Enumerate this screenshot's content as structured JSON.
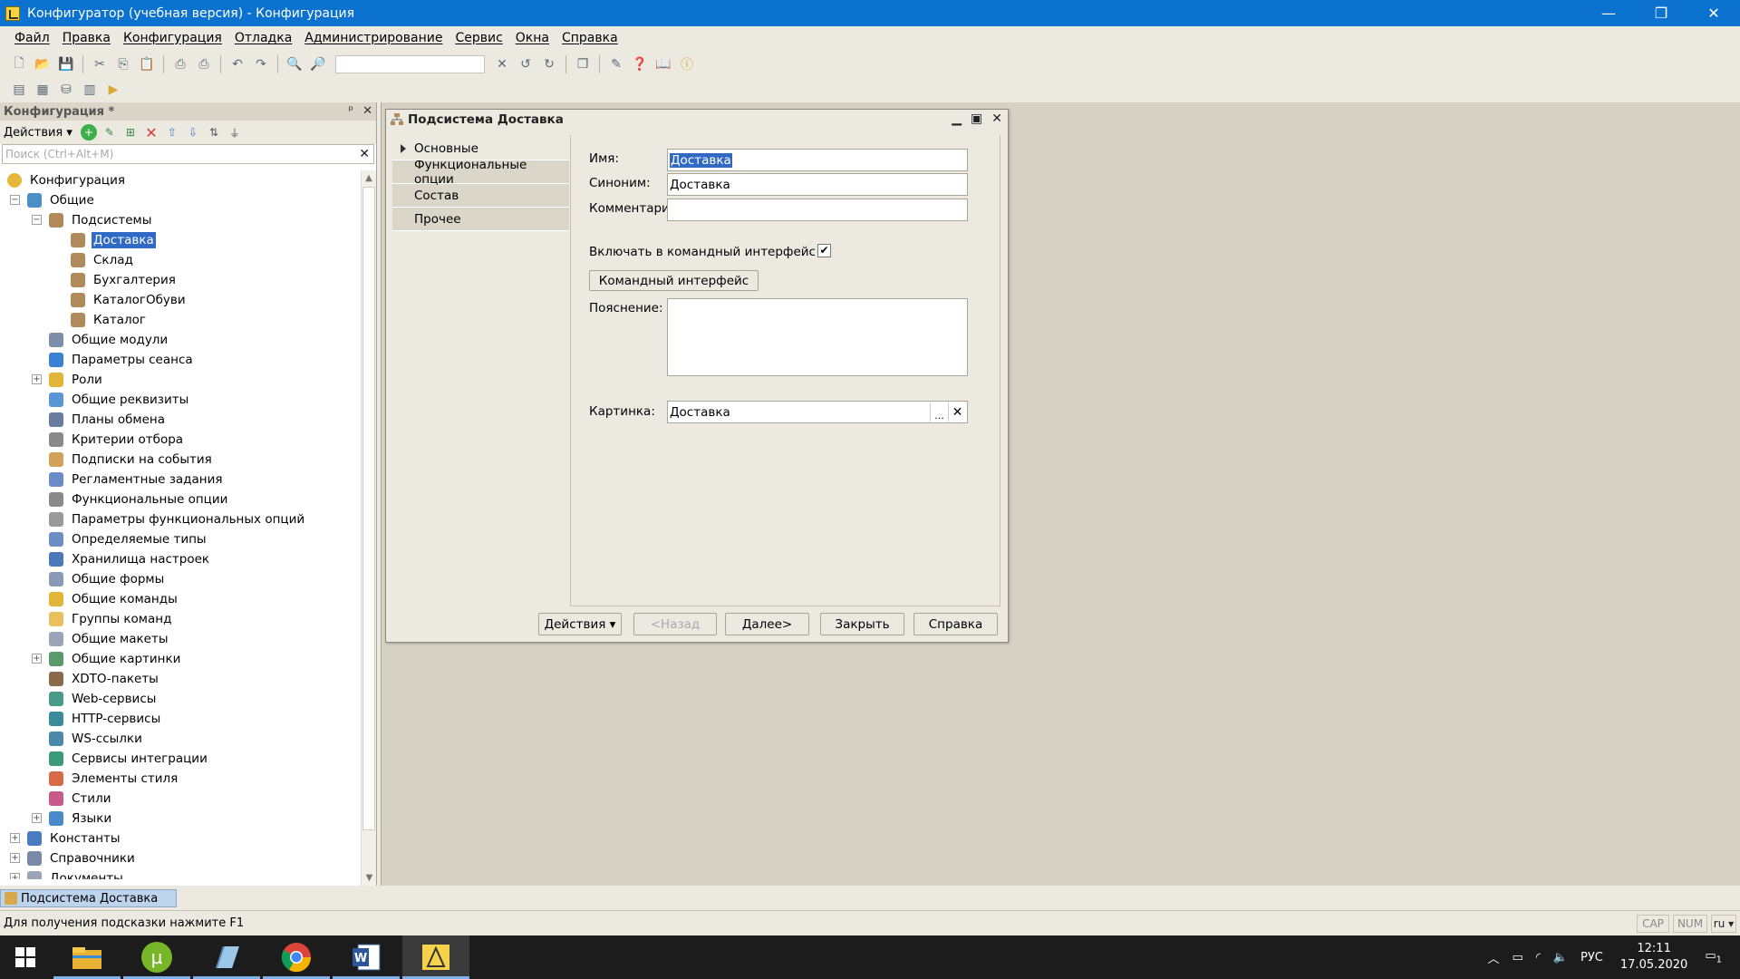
{
  "window": {
    "title": "Конфигуратор (учебная версия) - Конфигурация",
    "minimize": "—",
    "restore": "❐",
    "close": "✕"
  },
  "menu": [
    "Файл",
    "Правка",
    "Конфигурация",
    "Отладка",
    "Администрирование",
    "Сервис",
    "Окна",
    "Справка"
  ],
  "panel": {
    "title": "Конфигурация *",
    "pin": "ᵖ",
    "close": "✕",
    "actions_label": "Действия ▾",
    "search_placeholder": "Поиск (Ctrl+Alt+M)",
    "tree": [
      {
        "label": "Конфигурация",
        "level": 0,
        "exp": "",
        "color": "#e6b73a"
      },
      {
        "label": "Общие",
        "level": 1,
        "exp": "⊖",
        "color": "#4a90c8"
      },
      {
        "label": "Подсистемы",
        "level": 2,
        "exp": "⊖",
        "color": "#b08a5a"
      },
      {
        "label": "Доставка",
        "level": 3,
        "exp": "",
        "color": "#b08a5a",
        "selected": true
      },
      {
        "label": "Склад",
        "level": 3,
        "exp": "",
        "color": "#b08a5a"
      },
      {
        "label": "Бухгалтерия",
        "level": 3,
        "exp": "",
        "color": "#b08a5a"
      },
      {
        "label": "КаталогОбуви",
        "level": 3,
        "exp": "",
        "color": "#b08a5a"
      },
      {
        "label": "Каталог",
        "level": 3,
        "exp": "",
        "color": "#b08a5a"
      },
      {
        "label": "Общие модули",
        "level": 2,
        "exp": "",
        "color": "#7d8fa8"
      },
      {
        "label": "Параметры сеанса",
        "level": 2,
        "exp": "",
        "color": "#3d7fd1"
      },
      {
        "label": "Роли",
        "level": 2,
        "exp": "⊕",
        "color": "#e2b43a"
      },
      {
        "label": "Общие реквизиты",
        "level": 2,
        "exp": "",
        "color": "#5a95d6"
      },
      {
        "label": "Планы обмена",
        "level": 2,
        "exp": "",
        "color": "#6a7ca0"
      },
      {
        "label": "Критерии отбора",
        "level": 2,
        "exp": "",
        "color": "#8a8a8a"
      },
      {
        "label": "Подписки на события",
        "level": 2,
        "exp": "",
        "color": "#d2a25a"
      },
      {
        "label": "Регламентные задания",
        "level": 2,
        "exp": "",
        "color": "#6c8cc8"
      },
      {
        "label": "Функциональные опции",
        "level": 2,
        "exp": "",
        "color": "#8a8a8a"
      },
      {
        "label": "Параметры функциональных опций",
        "level": 2,
        "exp": "",
        "color": "#9a9a9a"
      },
      {
        "label": "Определяемые типы",
        "level": 2,
        "exp": "",
        "color": "#6b8fc4"
      },
      {
        "label": "Хранилища настроек",
        "level": 2,
        "exp": "",
        "color": "#4a78b8"
      },
      {
        "label": "Общие формы",
        "level": 2,
        "exp": "",
        "color": "#8a9ab4"
      },
      {
        "label": "Общие команды",
        "level": 2,
        "exp": "",
        "color": "#e2b43a"
      },
      {
        "label": "Группы команд",
        "level": 2,
        "exp": "",
        "color": "#e8c060"
      },
      {
        "label": "Общие макеты",
        "level": 2,
        "exp": "",
        "color": "#9aa6b8"
      },
      {
        "label": "Общие картинки",
        "level": 2,
        "exp": "⊕",
        "color": "#5a9a6a"
      },
      {
        "label": "XDTO-пакеты",
        "level": 2,
        "exp": "",
        "color": "#8a6a4a"
      },
      {
        "label": "Web-сервисы",
        "level": 2,
        "exp": "",
        "color": "#4a9a8a"
      },
      {
        "label": "HTTP-сервисы",
        "level": 2,
        "exp": "",
        "color": "#3a8a9a"
      },
      {
        "label": "WS-ссылки",
        "level": 2,
        "exp": "",
        "color": "#4a8aa8"
      },
      {
        "label": "Сервисы интеграции",
        "level": 2,
        "exp": "",
        "color": "#3a9a7a"
      },
      {
        "label": "Элементы стиля",
        "level": 2,
        "exp": "",
        "color": "#d86a4a"
      },
      {
        "label": "Стили",
        "level": 2,
        "exp": "",
        "color": "#c85a8a"
      },
      {
        "label": "Языки",
        "level": 2,
        "exp": "⊕",
        "color": "#4a8ac8"
      },
      {
        "label": "Константы",
        "level": 1,
        "exp": "⊕",
        "color": "#4a7ac0"
      },
      {
        "label": "Справочники",
        "level": 1,
        "exp": "⊕",
        "color": "#7a8aa8"
      },
      {
        "label": "Документы",
        "level": 1,
        "exp": "⊕",
        "color": "#9aa6b8"
      }
    ]
  },
  "openwin": "Подсистема Доставка",
  "dialog": {
    "title": "Подсистема Доставка",
    "nav": [
      "Основные",
      "Функциональные опции",
      "Состав",
      "Прочее"
    ],
    "name_label": "Имя:",
    "name_value": "Доставка",
    "synonym_label": "Синоним:",
    "synonym_value": "Доставка",
    "comment_label": "Комментарий:",
    "comment_value": "",
    "include_label": "Включать в командный интерфейс",
    "include_check": "✔",
    "cmd_btn": "Командный интерфейс",
    "expl_label": "Пояснение:",
    "pic_label": "Картинка:",
    "pic_value": "Доставка",
    "pic_dots": "...",
    "pic_clear": "✕",
    "footer": {
      "actions": "Действия ▾",
      "back": "<Назад",
      "next": "Далее>",
      "close": "Закрыть",
      "help": "Справка"
    }
  },
  "status": {
    "hint": "Для получения подсказки нажмите F1",
    "cap": "CAP",
    "num": "NUM",
    "lang": "ru ▾"
  },
  "tray": {
    "lang": "РУС",
    "time": "12:11",
    "date": "17.05.2020",
    "notif": "1"
  }
}
